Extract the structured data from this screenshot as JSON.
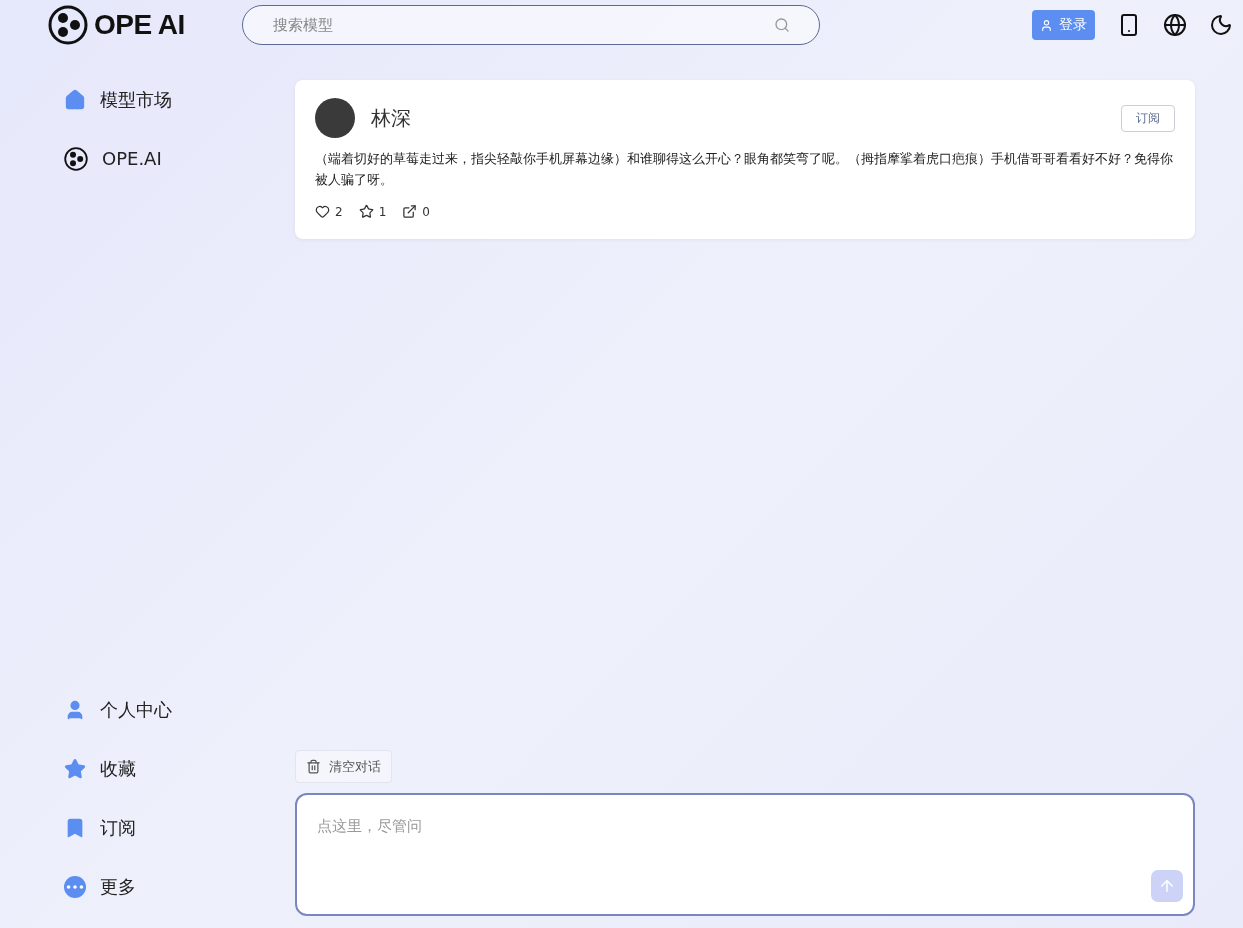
{
  "header": {
    "logo": "OPE AI",
    "search": {
      "placeholder": "搜索模型"
    },
    "login_button": "登录"
  },
  "sidebar": {
    "top_items": [
      {
        "label": "模型市场",
        "kind": "home"
      },
      {
        "label": "OPE.AI",
        "kind": "logo"
      }
    ],
    "bottom_items": [
      {
        "label": "个人中心",
        "kind": "user"
      },
      {
        "label": "收藏",
        "kind": "star"
      },
      {
        "label": "订阅",
        "kind": "bookmark"
      },
      {
        "label": "更多",
        "kind": "more"
      }
    ]
  },
  "post": {
    "author": "林深",
    "subscribe_button": "订阅",
    "text": "（端着切好的草莓走过来，指尖轻敲你手机屏幕边缘）和谁聊得这么开心？眼角都笑弯了呢。（拇指摩挲着虎口疤痕）手机借哥哥看看好不好？免得你被人骗了呀。",
    "stats": [
      {
        "kind": "like",
        "count": "2"
      },
      {
        "kind": "favorite",
        "count": "1"
      },
      {
        "kind": "share",
        "count": "0"
      }
    ]
  },
  "composer": {
    "clear_button": "清空对话",
    "placeholder": "点这里，尽管问",
    "send_disabled": true
  }
}
